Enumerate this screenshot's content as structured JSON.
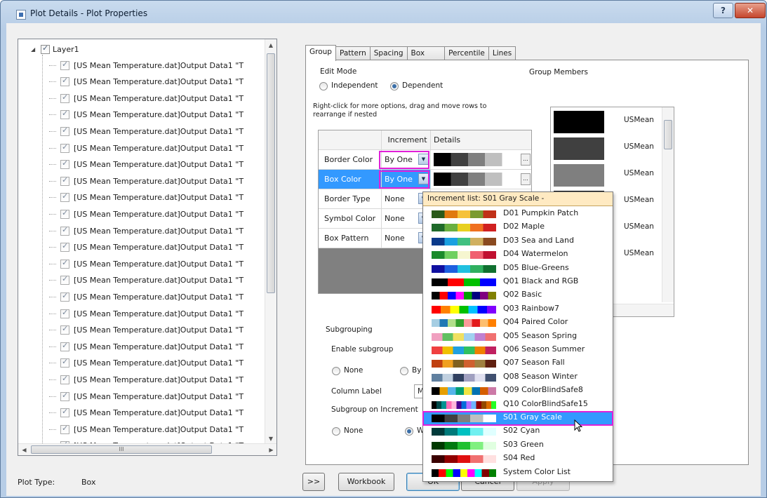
{
  "window": {
    "title": "Plot Details - Plot Properties",
    "help_glyph": "?",
    "close_glyph": "✕"
  },
  "tree": {
    "root_label": "Layer1",
    "item_label": "[US Mean Temperature.dat]Output Data1 \"T",
    "item_count": 24,
    "up_arrow": "▲",
    "down_arrow": "▼",
    "hscroll_grip": "III"
  },
  "plot_type": {
    "label": "Plot Type:",
    "value": "Box"
  },
  "tabs": [
    "Group",
    "Pattern",
    "Spacing",
    "Box",
    "Percentile",
    "Lines"
  ],
  "edit_mode": {
    "label": "Edit Mode",
    "independent": "Independent",
    "dependent": "Dependent",
    "selected": "Dependent"
  },
  "hint": "Right-click for more options, drag and move rows to  rearrange if nested",
  "grid": {
    "headers": [
      "",
      "Increment",
      "Details"
    ],
    "rows": [
      {
        "name": "Border Color",
        "increment": "By One",
        "details": "gray-scale"
      },
      {
        "name": "Box Color",
        "increment": "By One",
        "details": "gray-scale",
        "selected": true
      },
      {
        "name": "Border Type",
        "increment": "None"
      },
      {
        "name": "Symbol Color",
        "increment": "None"
      },
      {
        "name": "Box Pattern",
        "increment": "None"
      }
    ],
    "ellipsis": "..."
  },
  "group_members": {
    "label": "Group Members",
    "colors": [
      "#000000",
      "#404040",
      "#7f7f7f",
      "#000000",
      "#404040",
      "#7f7f7f",
      "#000000"
    ],
    "member_label": "USMean"
  },
  "subgrouping": {
    "label": "Subgrouping",
    "enable": "Enable subgroup",
    "none": "None",
    "by_s": "By S",
    "column_label": "Column Label",
    "column_label_value": "Mo",
    "on_increment": "Subgroup on Increment",
    "none2": "None",
    "wi": "Wi"
  },
  "popup": {
    "header": "Increment list: S01 Gray Scale -",
    "selected": "S01 Gray Scale",
    "items": [
      {
        "name": "D01 Pumpkin Patch",
        "colors": [
          "#2a5a1a",
          "#e07a10",
          "#f6c23a",
          "#7a9a30",
          "#c03018"
        ]
      },
      {
        "name": "D02 Maple",
        "colors": [
          "#1f6a2a",
          "#6ab040",
          "#e8d020",
          "#f07020",
          "#d02020"
        ]
      },
      {
        "name": "D03 Sea and Land",
        "colors": [
          "#0a3a8a",
          "#1aa0e0",
          "#40c080",
          "#d0b060",
          "#8a4a20"
        ]
      },
      {
        "name": "D04 Watermelon",
        "colors": [
          "#1a8a2a",
          "#70d060",
          "#f6f6d0",
          "#f06070",
          "#c01030"
        ]
      },
      {
        "name": "D05 Blue-Greens",
        "colors": [
          "#1010a0",
          "#1e60e0",
          "#20c0e0",
          "#30b060",
          "#107030"
        ]
      },
      {
        "name": "Q01 Black and RGB",
        "colors": [
          "#000000",
          "#ff0000",
          "#00c000",
          "#0000ff"
        ]
      },
      {
        "name": "Q02 Basic",
        "colors": [
          "#000000",
          "#ff0000",
          "#0000ff",
          "#ff00ff",
          "#00a000",
          "#000080",
          "#800080",
          "#808000"
        ]
      },
      {
        "name": "Q03 Rainbow7",
        "colors": [
          "#ff0000",
          "#ff8000",
          "#ffff00",
          "#00c000",
          "#00c0ff",
          "#0000ff",
          "#8000ff"
        ]
      },
      {
        "name": "Q04 Paired Color",
        "colors": [
          "#a6cee3",
          "#1f78b4",
          "#b2df8a",
          "#33a02c",
          "#fb9a99",
          "#e31a1c",
          "#fdbf6f",
          "#ff7f00"
        ]
      },
      {
        "name": "Q05 Season Spring",
        "colors": [
          "#f0a0c0",
          "#60c060",
          "#f0e060",
          "#a0d0f0",
          "#c080d0",
          "#f07070"
        ]
      },
      {
        "name": "Q06 Season Summer",
        "colors": [
          "#f04040",
          "#f0c000",
          "#20a0e0",
          "#30c060",
          "#f08000",
          "#c02060"
        ]
      },
      {
        "name": "Q07 Season Fall",
        "colors": [
          "#c04010",
          "#f0a020",
          "#806020",
          "#d06030",
          "#a08040",
          "#602010"
        ]
      },
      {
        "name": "Q08 Season Winter",
        "colors": [
          "#6080a0",
          "#c0d0e0",
          "#304060",
          "#a0a0c0",
          "#e0e0f0",
          "#405070"
        ]
      },
      {
        "name": "Q09 ColorBlindSafe8",
        "colors": [
          "#000000",
          "#e69f00",
          "#56b4e9",
          "#009e73",
          "#f0e442",
          "#0072b2",
          "#d55e00",
          "#cc79a7"
        ]
      },
      {
        "name": "Q10 ColorBlindSafe15",
        "colors": [
          "#000000",
          "#004949",
          "#009292",
          "#ff6db6",
          "#ffb6db",
          "#490092",
          "#006ddb",
          "#b66dff",
          "#6db6ff",
          "#920000",
          "#924900",
          "#db6d00",
          "#24ff24"
        ]
      },
      {
        "name": "S01 Gray Scale",
        "colors": [
          "#000000",
          "#404040",
          "#7f7f7f",
          "#bfbfbf",
          "#ffffff"
        ]
      },
      {
        "name": "S02 Cyan",
        "colors": [
          "#003a3a",
          "#007a7a",
          "#00c0c0",
          "#70f0f0",
          "#e0ffff"
        ]
      },
      {
        "name": "S03 Green",
        "colors": [
          "#003a00",
          "#007a10",
          "#20c030",
          "#80f080",
          "#e0ffe0"
        ]
      },
      {
        "name": "S04 Red",
        "colors": [
          "#3a0000",
          "#900000",
          "#e01010",
          "#f07070",
          "#ffe0e0"
        ]
      },
      {
        "name": "System Color List",
        "colors": [
          "#000000",
          "#ff0000",
          "#00ff00",
          "#0000ff",
          "#ffff00",
          "#ff00ff",
          "#00ffff",
          "#800000",
          "#008000"
        ]
      }
    ]
  },
  "buttons": {
    "expand": ">>",
    "workbook": "Workbook",
    "ok": "OK",
    "cancel": "Cancel",
    "apply": "Apply"
  }
}
